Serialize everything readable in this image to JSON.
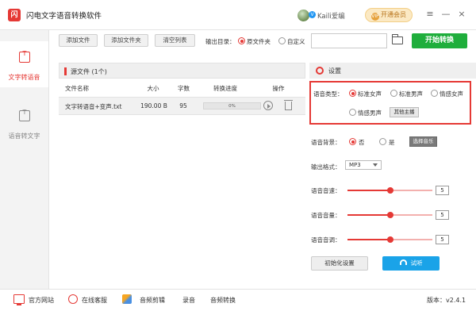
{
  "app": {
    "title": "闪电文字语音转换软件",
    "logo": "闪"
  },
  "user": {
    "name": "Kaili爱编",
    "badge": "V"
  },
  "vip": {
    "label": "开通会员",
    "icon": "VIP"
  },
  "window_controls": {
    "menu": "≡",
    "minimize": "—",
    "close": "×"
  },
  "sidebar": {
    "items": [
      {
        "label": "文字转语音",
        "icon": "text-to-speech-icon"
      },
      {
        "label": "语音转文字",
        "icon": "speech-to-text-icon"
      }
    ]
  },
  "toolbar": {
    "add_file": "添加文件",
    "add_folder": "添加文件夹",
    "clear_list": "清空列表",
    "output_label": "输出目录：",
    "output_options": [
      "原文件夹",
      "自定义"
    ],
    "output_path": "",
    "start": "开始转换"
  },
  "file_panel": {
    "title": "源文件 (1个)",
    "columns": [
      "文件名称",
      "大小",
      "字数",
      "转换进度",
      "操作"
    ],
    "rows": [
      {
        "name": "文字转语音+变声.txt",
        "size": "190.00 B",
        "words": "95",
        "progress": "0%",
        "progress_value": 0
      }
    ]
  },
  "settings": {
    "title": "设置",
    "voice_type_label": "语音类型：",
    "voice_types": [
      "标准女声",
      "标准男声",
      "情感女声",
      "情感男声"
    ],
    "selected_voice": "标准女声",
    "other_anchor": "其他主播",
    "bg_label": "语音背景：",
    "bg_options": [
      "否",
      "是"
    ],
    "bg_selected": "否",
    "choose_music": "选择音乐",
    "format_label": "输出格式：",
    "format_value": "MP3",
    "speed_label": "语音音速：",
    "speed_value": "5",
    "volume_label": "语音音量：",
    "volume_value": "5",
    "pitch_label": "语音音调：",
    "pitch_value": "5",
    "slider_fraction": 0.5,
    "init": "初始化设置",
    "listen": "试听"
  },
  "footer": {
    "website": "官方网站",
    "service": "在线客服",
    "audio_edit": "音频剪辑",
    "record": "录音",
    "audio_convert": "音频转换",
    "version": "版本：v2.4.1"
  },
  "colors": {
    "accent": "#e53935",
    "start": "#1fae3c",
    "listen": "#1aa3e8"
  }
}
